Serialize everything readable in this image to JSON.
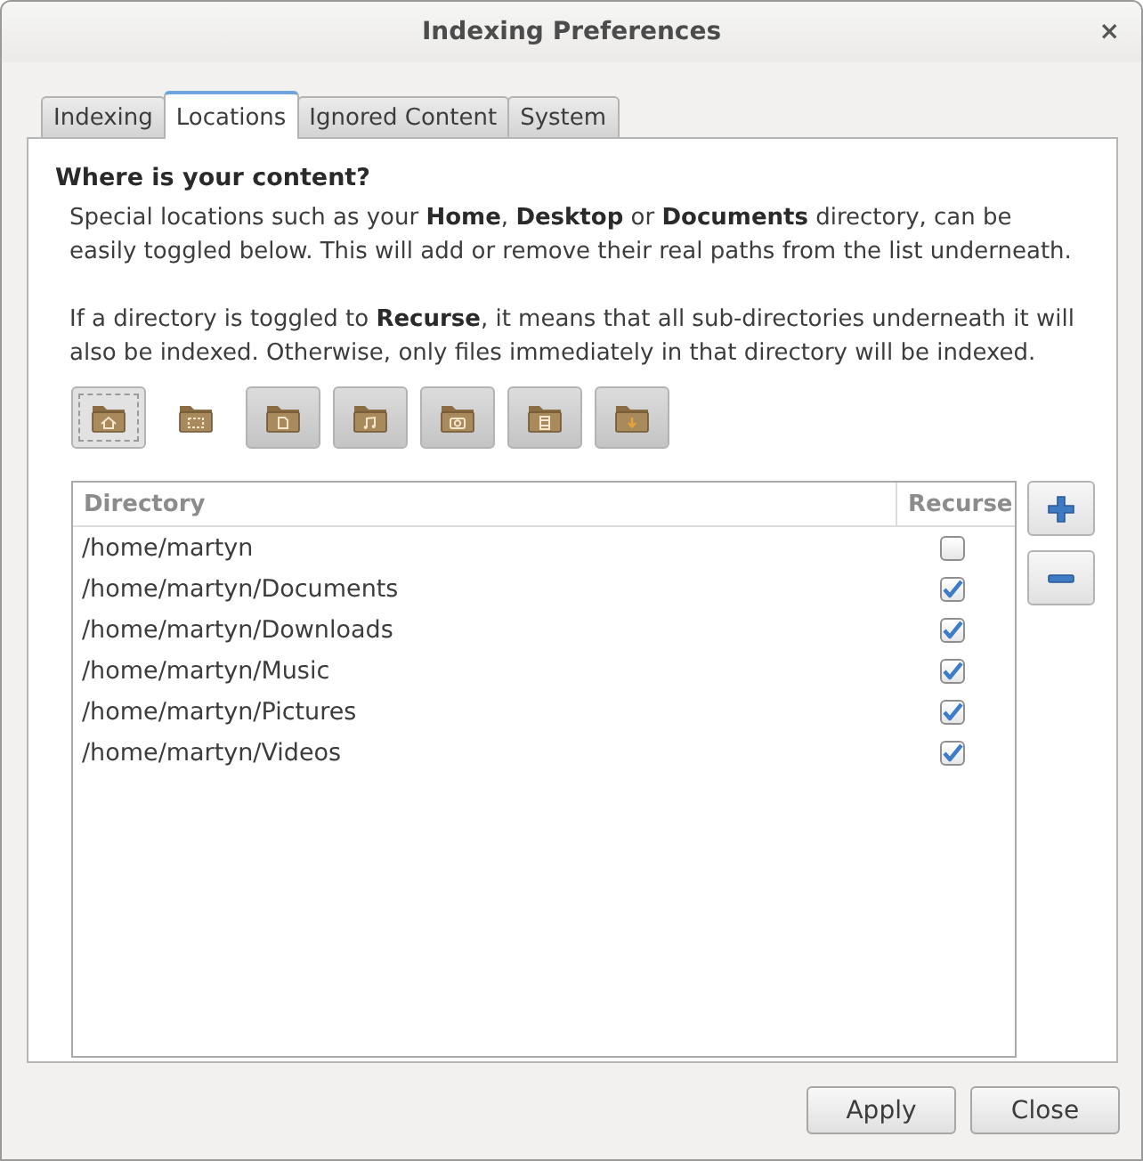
{
  "window": {
    "title": "Indexing Preferences",
    "close": "×"
  },
  "tabs": [
    {
      "label": "Indexing",
      "selected": false
    },
    {
      "label": "Locations",
      "selected": true
    },
    {
      "label": "Ignored Content",
      "selected": false
    },
    {
      "label": "System",
      "selected": false
    }
  ],
  "heading": "Where is your content?",
  "paragraphs": [
    "Special locations such as your **Home**, **Desktop** or **Documents** directory, can be easily toggled below. This will add or remove their real paths from the list underneath.",
    "If a directory is toggled to **Recurse**, it means that all sub-directories underneath it will also be indexed. Otherwise, only files immediately in that directory will be indexed."
  ],
  "toggles": [
    {
      "kind": "home",
      "on": true,
      "focused": true
    },
    {
      "kind": "desktop",
      "on": false,
      "focused": false
    },
    {
      "kind": "documents",
      "on": true,
      "focused": false
    },
    {
      "kind": "music",
      "on": true,
      "focused": false
    },
    {
      "kind": "pictures",
      "on": true,
      "focused": false
    },
    {
      "kind": "videos",
      "on": true,
      "focused": false
    },
    {
      "kind": "downloads",
      "on": true,
      "focused": false
    }
  ],
  "table": {
    "columns": [
      "Directory",
      "Recurse"
    ],
    "rows": [
      {
        "directory": "/home/martyn",
        "recurse": false
      },
      {
        "directory": "/home/martyn/Documents",
        "recurse": true
      },
      {
        "directory": "/home/martyn/Downloads",
        "recurse": true
      },
      {
        "directory": "/home/martyn/Music",
        "recurse": true
      },
      {
        "directory": "/home/martyn/Pictures",
        "recurse": true
      },
      {
        "directory": "/home/martyn/Videos",
        "recurse": true
      }
    ]
  },
  "side_buttons": [
    {
      "kind": "add"
    },
    {
      "kind": "remove"
    }
  ],
  "buttons": [
    "Apply",
    "Close"
  ]
}
